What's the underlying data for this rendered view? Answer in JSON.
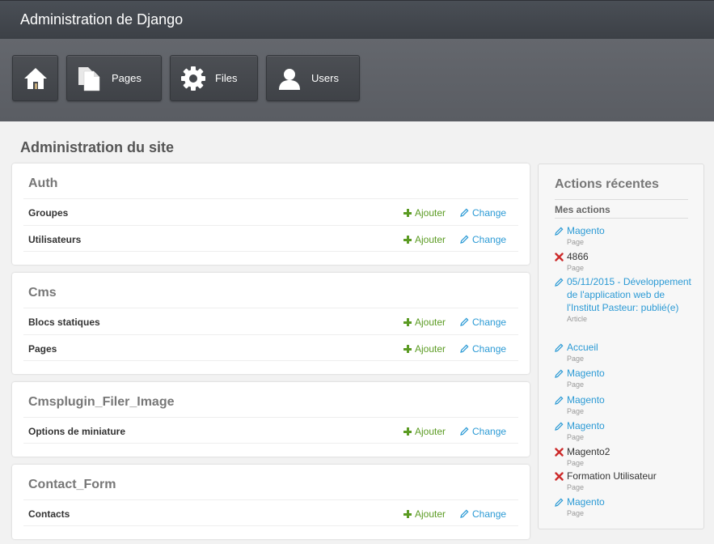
{
  "header": {
    "title": "Administration de Django"
  },
  "nav": [
    {
      "label": "",
      "icon": "home-icon"
    },
    {
      "label": "Pages",
      "icon": "pages-icon"
    },
    {
      "label": "Files",
      "icon": "gear-icon"
    },
    {
      "label": "Users",
      "icon": "user-icon"
    }
  ],
  "page_title": "Administration du site",
  "modules": [
    {
      "title": "Auth",
      "rows": [
        {
          "name": "Groupes",
          "add": "Ajouter",
          "change": "Change"
        },
        {
          "name": "Utilisateurs",
          "add": "Ajouter",
          "change": "Change"
        }
      ]
    },
    {
      "title": "Cms",
      "rows": [
        {
          "name": "Blocs statiques",
          "add": "Ajouter",
          "change": "Change"
        },
        {
          "name": "Pages",
          "add": "Ajouter",
          "change": "Change"
        }
      ]
    },
    {
      "title": "Cmsplugin_Filer_Image",
      "rows": [
        {
          "name": "Options de miniature",
          "add": "Ajouter",
          "change": "Change"
        }
      ]
    },
    {
      "title": "Contact_Form",
      "rows": [
        {
          "name": "Contacts",
          "add": "Ajouter",
          "change": "Change"
        }
      ]
    }
  ],
  "sidebar": {
    "title": "Actions récentes",
    "subtitle": "Mes actions",
    "actions": [
      {
        "kind": "change",
        "text": "Magento",
        "type": "Page"
      },
      {
        "kind": "delete",
        "text": "4866",
        "type": "Page"
      },
      {
        "kind": "change",
        "text": "05/11/2015 - Développement de l'application web de l'Institut Pasteur: publié(e)",
        "type": "Article"
      },
      {
        "kind": "change",
        "text": "Accueil",
        "type": "Page"
      },
      {
        "kind": "change",
        "text": "Magento",
        "type": "Page"
      },
      {
        "kind": "change",
        "text": "Magento",
        "type": "Page"
      },
      {
        "kind": "change",
        "text": "Magento",
        "type": "Page"
      },
      {
        "kind": "delete",
        "text": "Magento2",
        "type": "Page"
      },
      {
        "kind": "delete",
        "text": "Formation Utilisateur",
        "type": "Page"
      },
      {
        "kind": "change",
        "text": "Magento",
        "type": "Page"
      }
    ]
  },
  "colors": {
    "add": "#5b9b23",
    "change": "#2b9ad5",
    "delete": "#cc2a2a"
  }
}
